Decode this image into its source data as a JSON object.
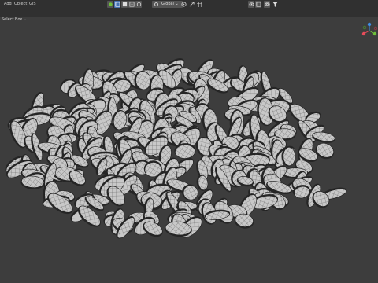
{
  "menu": {
    "items": [
      {
        "label": "Add"
      },
      {
        "label": "Object"
      },
      {
        "label": "GIS"
      }
    ]
  },
  "header": {
    "mode_label": "Select Box",
    "orientation_label": "Global"
  },
  "toolbar": {
    "icons": [
      "object-mode-icon",
      "viewport-shading-icon",
      "select-box-icon",
      "transform-pivot-icon",
      "snap-icon",
      "proportional-edit-icon",
      "overlay-icon",
      "xray-icon",
      "filter-icon"
    ]
  },
  "gizmo": {
    "axes": [
      {
        "name": "X",
        "color": "#e74c5a"
      },
      {
        "name": "Y",
        "color": "#6fbf3a"
      },
      {
        "name": "Z",
        "color": "#3f8fe8"
      }
    ]
  },
  "colors": {
    "background": "#3d3d3d",
    "header": "#303030",
    "accent": "#4772b3",
    "seed_face": "#c9c9c9",
    "wire": "#2a2a2a"
  }
}
